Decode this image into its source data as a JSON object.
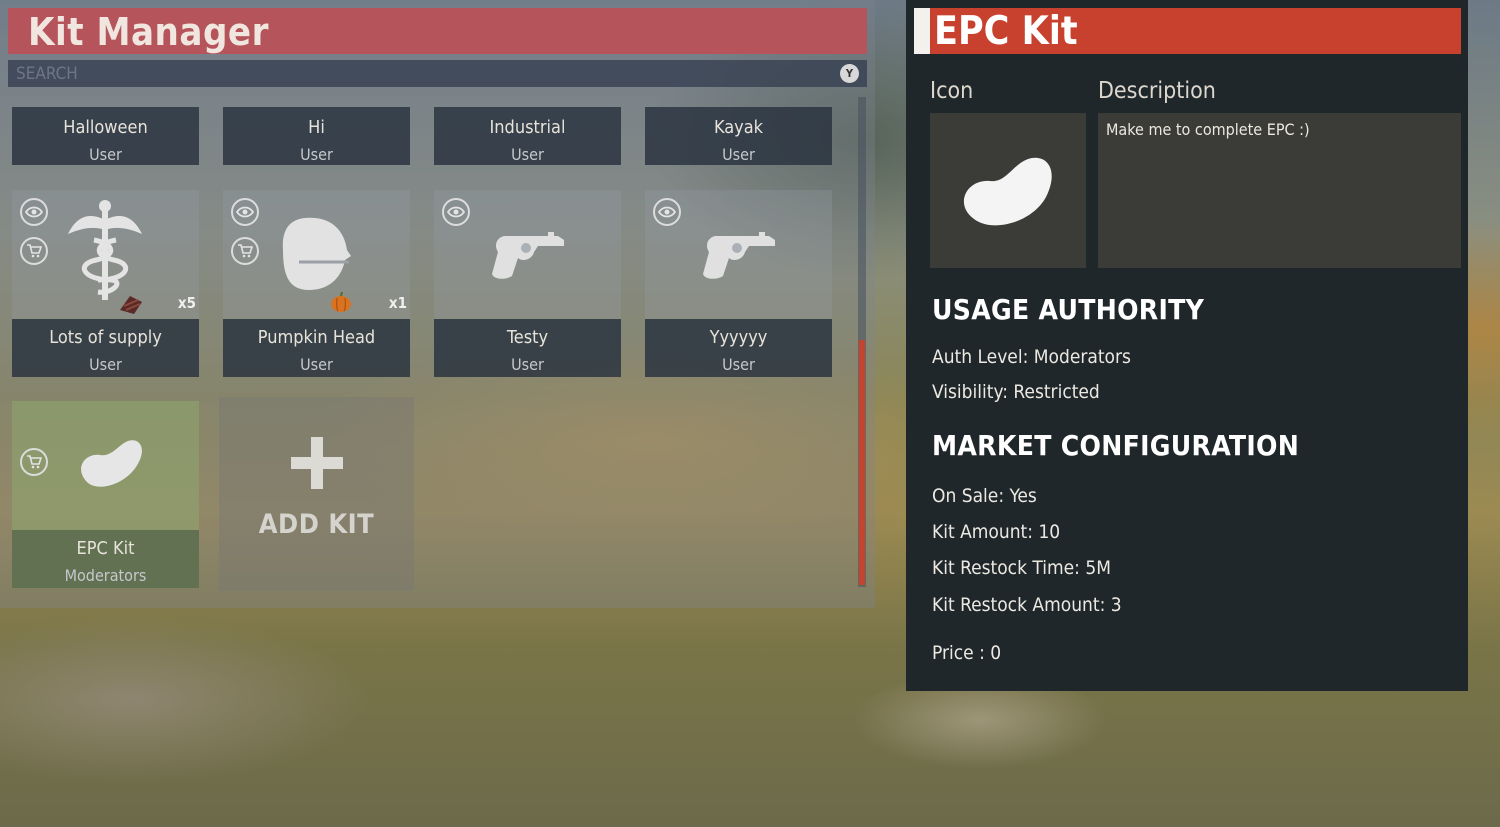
{
  "kit_manager": {
    "title": "Kit Manager",
    "search": {
      "placeholder": "SEARCH",
      "clear_label": "Y"
    },
    "kits": [
      {
        "name": "Halloween",
        "auth": "User"
      },
      {
        "name": "Hi",
        "auth": "User"
      },
      {
        "name": "Industrial",
        "auth": "User"
      },
      {
        "name": "Kayak",
        "auth": "User"
      },
      {
        "name": "Lots of supply",
        "auth": "User",
        "qty": "x5",
        "icon": "caduceus-icon",
        "badge": "supply-item-icon"
      },
      {
        "name": "Pumpkin Head",
        "auth": "User",
        "qty": "x1",
        "icon": "helmet-icon",
        "badge": "pumpkin-icon"
      },
      {
        "name": "Testy",
        "auth": "User",
        "icon": "revolver-icon"
      },
      {
        "name": "Yyyyyy",
        "auth": "User",
        "icon": "revolver-icon"
      },
      {
        "name": "EPC Kit",
        "auth": "Moderators",
        "icon": "bean-icon"
      }
    ],
    "add_kit_label": "ADD KIT"
  },
  "detail": {
    "title": "EPC Kit",
    "icon_label": "Icon",
    "description_label": "Description",
    "description": "Make me to complete EPC :)",
    "usage_heading": "USAGE AUTHORITY",
    "auth_level": "Auth Level: Moderators",
    "visibility": "Visibility: Restricted",
    "market_heading": "MARKET CONFIGURATION",
    "on_sale": "On Sale: Yes",
    "kit_amount": "Kit Amount: 10",
    "restock_time": "Kit Restock Time: 5M",
    "restock_amount": "Kit Restock Amount: 3",
    "price": "Price : 0"
  },
  "colors": {
    "accent_red": "#c8412e",
    "manager_title": "#b5545a",
    "panel_dark": "#20272b"
  }
}
